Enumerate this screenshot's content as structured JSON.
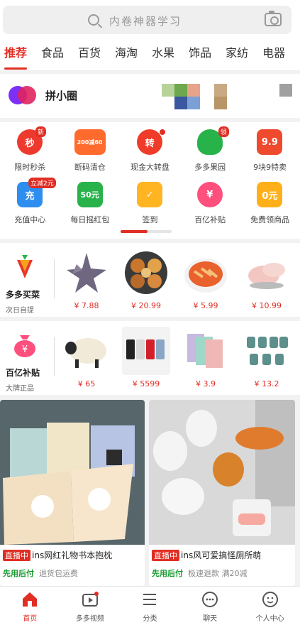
{
  "search": {
    "placeholder": "内卷神器学习"
  },
  "categories": [
    "推荐",
    "食品",
    "百货",
    "海淘",
    "水果",
    "饰品",
    "家纺",
    "电器"
  ],
  "pxq": {
    "title": "拼小圈"
  },
  "grid_row1": [
    {
      "label": "限时秒杀",
      "icon_text": "秒",
      "badge": "新",
      "color": "#ee3a2e"
    },
    {
      "label": "断码清仓",
      "icon_text": "200减60",
      "color": "#ff6b2c"
    },
    {
      "label": "现金大转盘",
      "icon_text": "转",
      "color": "#ef3b2a"
    },
    {
      "label": "多多果园",
      "icon_text": "",
      "badge": "领",
      "color": "#27b34a"
    },
    {
      "label": "9块9特卖",
      "icon_text": "9.9",
      "color": "#f04a2e"
    }
  ],
  "grid_row2": [
    {
      "label": "充值中心",
      "icon_text": "充",
      "badge": "立减2元",
      "color": "#2d8ef0"
    },
    {
      "label": "每日摇红包",
      "icon_text": "50元",
      "color": "#27b34a"
    },
    {
      "label": "签到",
      "icon_text": "",
      "color": "#ffb522"
    },
    {
      "label": "百亿补贴",
      "icon_text": "¥",
      "color": "#ff4f7d"
    },
    {
      "label": "免费领商品",
      "icon_text": "0元",
      "color": "#ffb019"
    }
  ],
  "maicai": {
    "title": "多多买菜",
    "sub": "次日自提",
    "prices": [
      "¥ 7.88",
      "¥ 20.99",
      "¥ 5.99",
      "¥ 10.99"
    ]
  },
  "butie": {
    "title": "百亿补贴",
    "sub": "大牌正品",
    "prices": [
      "¥ 65",
      "¥ 5599",
      "¥ 3.9",
      "¥ 13.2"
    ]
  },
  "feed": [
    {
      "live": "直播中",
      "title": "ins网红礼物书本抱枕",
      "tag": "先用后付",
      "note": "退货包运费"
    },
    {
      "live": "直播中",
      "title": "ins风可爱搞怪厕所萌",
      "tag": "先用后付",
      "note": "极速退款  满20减"
    }
  ],
  "nav": [
    "首页",
    "多多视频",
    "分类",
    "聊天",
    "个人中心"
  ]
}
